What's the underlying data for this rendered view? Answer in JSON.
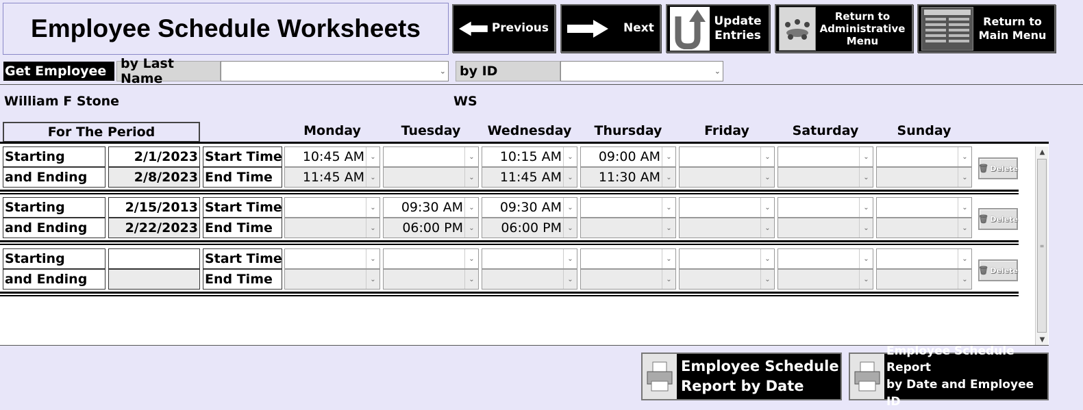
{
  "title": "Employee Schedule Worksheets",
  "nav": {
    "previous": "Previous",
    "next": "Next",
    "update_line1": "Update",
    "update_line2": "Entries",
    "admin_line1": "Return to",
    "admin_line2": "Administrative",
    "admin_line3": "Menu",
    "main_line1": "Return to",
    "main_line2": "Main Menu"
  },
  "search": {
    "get_employee": "Get Employee",
    "by_last_name": "by Last Name",
    "last_name_value": "",
    "by_id": "by ID",
    "id_value": ""
  },
  "employee": {
    "name": "William F Stone",
    "initials": "WS"
  },
  "period_header": "For The Period",
  "days": [
    "Monday",
    "Tuesday",
    "Wednesday",
    "Thursday",
    "Friday",
    "Saturday",
    "Sunday"
  ],
  "labels": {
    "starting": "Starting",
    "ending": "and Ending",
    "start_time": "Start Time",
    "end_time": "End Time",
    "delete": "Delete"
  },
  "records": [
    {
      "start_date": "2/1/2023",
      "end_date": "2/8/2023",
      "start_times": [
        "10:45 AM",
        "",
        "10:15 AM",
        "09:00 AM",
        "",
        "",
        ""
      ],
      "end_times": [
        "11:45 AM",
        "",
        "11:45 AM",
        "11:30 AM",
        "",
        "",
        ""
      ]
    },
    {
      "start_date": "2/15/2013",
      "end_date": "2/22/2023",
      "start_times": [
        "",
        "09:30 AM",
        "09:30 AM",
        "",
        "",
        "",
        ""
      ],
      "end_times": [
        "",
        "06:00 PM",
        "06:00 PM",
        "",
        "",
        "",
        ""
      ]
    },
    {
      "start_date": "",
      "end_date": "",
      "start_times": [
        "",
        "",
        "",
        "",
        "",
        "",
        ""
      ],
      "end_times": [
        "",
        "",
        "",
        "",
        "",
        "",
        ""
      ]
    }
  ],
  "reports": {
    "by_date_line1": "Employee Schedule",
    "by_date_line2": "Report by Date",
    "by_date_id_line1": "Employee Schedule Report",
    "by_date_id_line2": "by Date and Employee ID"
  },
  "icons": {
    "previous": "left-arrow-icon",
    "next": "right-arrow-icon",
    "update": "u-turn-arrow-icon",
    "admin": "team-meeting-icon",
    "main": "menu-thumbnail-icon",
    "printer": "printer-icon",
    "delete": "trash-icon",
    "dropdown": "chevron-down-icon"
  }
}
